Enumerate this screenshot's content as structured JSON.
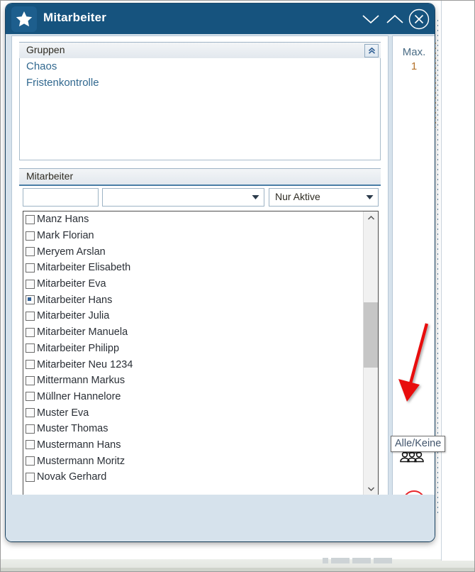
{
  "window": {
    "title": "Mitarbeiter",
    "app_icon": "star-icon",
    "buttons": {
      "minimize": "chevron-down-icon",
      "maximize": "chevron-up-icon",
      "close": "close-circle-icon"
    }
  },
  "groups_panel": {
    "header": "Gruppen",
    "collapse_icon": "double-chevron-up-icon",
    "items": [
      {
        "label": "Chaos"
      },
      {
        "label": "Fristenkontrolle"
      }
    ]
  },
  "employees_panel": {
    "header": "Mitarbeiter",
    "filter": {
      "text_value": "",
      "text_placeholder": "",
      "combo_value": "",
      "combo_arrow_icon": "chevron-down-icon",
      "status_value": "Nur Aktive",
      "status_arrow_icon": "chevron-down-icon"
    },
    "scrollbar": {
      "up_icon": "chevron-up-icon",
      "down_icon": "chevron-down-icon"
    },
    "rows": [
      {
        "label": "Manz Hans",
        "checked": false
      },
      {
        "label": "Mark Florian",
        "checked": false
      },
      {
        "label": "Meryem Arslan",
        "checked": false
      },
      {
        "label": "Mitarbeiter Elisabeth",
        "checked": false
      },
      {
        "label": "Mitarbeiter Eva",
        "checked": false
      },
      {
        "label": "Mitarbeiter Hans",
        "checked": true
      },
      {
        "label": "Mitarbeiter Julia",
        "checked": false
      },
      {
        "label": "Mitarbeiter Manuela",
        "checked": false
      },
      {
        "label": "Mitarbeiter Philipp",
        "checked": false
      },
      {
        "label": "Mitarbeiter Neu 1234",
        "checked": false
      },
      {
        "label": "Mittermann Markus",
        "checked": false
      },
      {
        "label": "Müllner Hannelore",
        "checked": false
      },
      {
        "label": "Muster Eva",
        "checked": false
      },
      {
        "label": "Muster Thomas",
        "checked": false
      },
      {
        "label": "Mustermann Hans",
        "checked": false
      },
      {
        "label": "Mustermann Moritz",
        "checked": false
      },
      {
        "label": "Novak Gerhard",
        "checked": false
      }
    ]
  },
  "side_column": {
    "max_label": "Max.",
    "max_value": "1",
    "buttons": [
      {
        "name": "select-all-none-button",
        "icon": "people-group-icon"
      },
      {
        "name": "cancel-button",
        "icon": "red-x-circle-icon"
      },
      {
        "name": "confirm-button",
        "icon": "green-check-icon"
      }
    ]
  },
  "tooltip": {
    "text": "Alle/Keine"
  },
  "annotation": {
    "type": "red-arrow",
    "points_to": "select-all-none-button"
  },
  "colors": {
    "titlebar": "#16537e",
    "dialog_bg": "#d6e2ec",
    "group_item_text": "#31688f",
    "max_value_text": "#b5712a",
    "checkbox_fill": "#2f5f95",
    "annotation_red": "#e8110f",
    "confirm_green": "#72c46a",
    "cancel_red": "#e8262a"
  }
}
